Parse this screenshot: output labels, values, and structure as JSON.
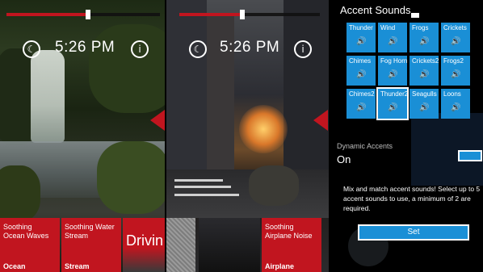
{
  "colors": {
    "accent_red": "#c1151f",
    "accent_blue": "#1a8fd6",
    "background": "#000000"
  },
  "icons": {
    "moon": "moon-icon",
    "info": "info-icon",
    "speaker": "speaker-icon",
    "back_arrow": "red-triangle-icon"
  },
  "panel1": {
    "volume_level": 0.53,
    "time": "5:26 PM",
    "tiles": [
      {
        "title": "Soothing Ocean Waves",
        "category": "Ocean"
      },
      {
        "title": "Soothing Water Stream",
        "category": "Stream"
      },
      {
        "title": "Drivin"
      }
    ]
  },
  "panel2": {
    "volume_level": 0.45,
    "time": "5:26 PM",
    "tiles": [
      {
        "title": "Soothing Airplane Noise",
        "category": "Airplane"
      }
    ]
  },
  "panel3": {
    "title": "Accent Sounds",
    "sounds": [
      [
        "Thunder",
        "Wind",
        "Frogs",
        "Crickets"
      ],
      [
        "Chimes",
        "Fog Horn",
        "Crickets2",
        "Frogs2"
      ],
      [
        "Chimes2",
        "Thunder2",
        "Seagulls",
        "Loons"
      ]
    ],
    "dynamic_label": "Dynamic Accents",
    "dynamic_value": "On",
    "description": "Mix and match accent sounds! Select up to 5 accent sounds to use, a minimum of 2 are required.",
    "set_label": "Set"
  }
}
